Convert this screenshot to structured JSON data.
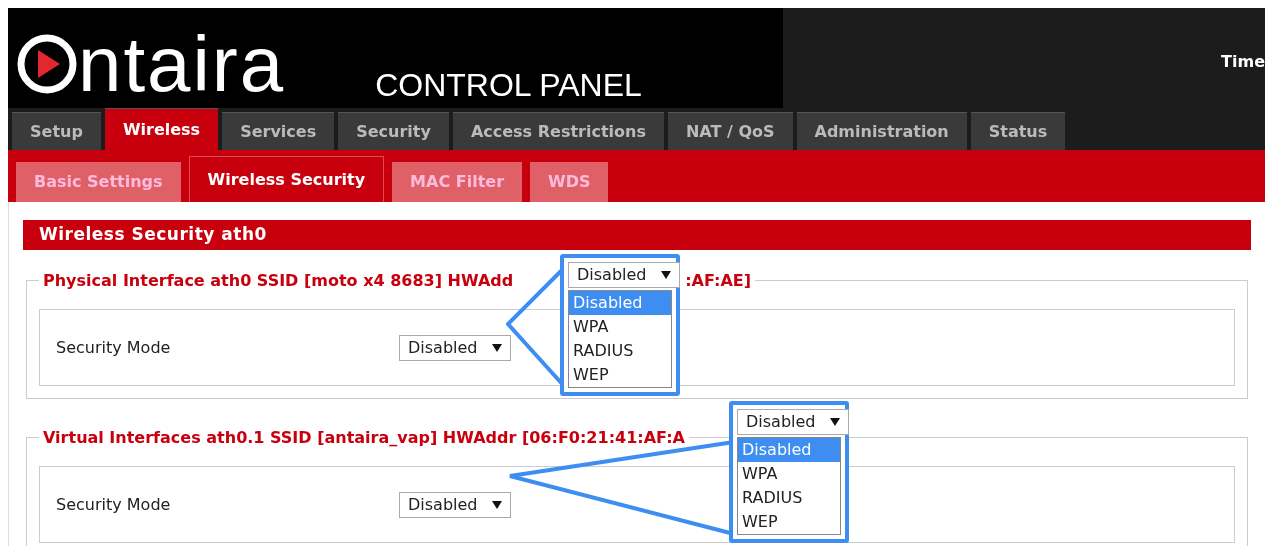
{
  "header": {
    "logo": "ntaira",
    "subtitle": "CONTROL PANEL",
    "time_label": "Time"
  },
  "tabs": [
    {
      "label": "Setup",
      "selected": false
    },
    {
      "label": "Wireless",
      "selected": true
    },
    {
      "label": "Services",
      "selected": false
    },
    {
      "label": "Security",
      "selected": false
    },
    {
      "label": "Access Restrictions",
      "selected": false
    },
    {
      "label": "NAT / QoS",
      "selected": false
    },
    {
      "label": "Administration",
      "selected": false
    },
    {
      "label": "Status",
      "selected": false
    }
  ],
  "subtabs": [
    {
      "label": "Basic Settings",
      "selected": false
    },
    {
      "label": "Wireless Security",
      "selected": true
    },
    {
      "label": "MAC Filter",
      "selected": false
    },
    {
      "label": "WDS",
      "selected": false
    }
  ],
  "section_title": "Wireless Security ath0",
  "interfaces": [
    {
      "legend": "Physical Interface ath0 SSID [moto x4 8683] HWAdd",
      "legend_end": ":AF:AE]",
      "field_label": "Security Mode",
      "value": "Disabled",
      "dropdown": {
        "value": "Disabled",
        "options": [
          {
            "label": "Disabled",
            "selected": true
          },
          {
            "label": "WPA",
            "selected": false
          },
          {
            "label": "RADIUS",
            "selected": false
          },
          {
            "label": "WEP",
            "selected": false
          }
        ]
      }
    },
    {
      "legend": "Virtual Interfaces ath0.1 SSID [antaira_vap] HWAddr [06:F0:21:41:AF:A",
      "field_label": "Security Mode",
      "value": "Disabled",
      "dropdown": {
        "value": "Disabled",
        "options": [
          {
            "label": "Disabled",
            "selected": true
          },
          {
            "label": "WPA",
            "selected": false
          },
          {
            "label": "RADIUS",
            "selected": false
          },
          {
            "label": "WEP",
            "selected": false
          }
        ]
      }
    }
  ]
}
